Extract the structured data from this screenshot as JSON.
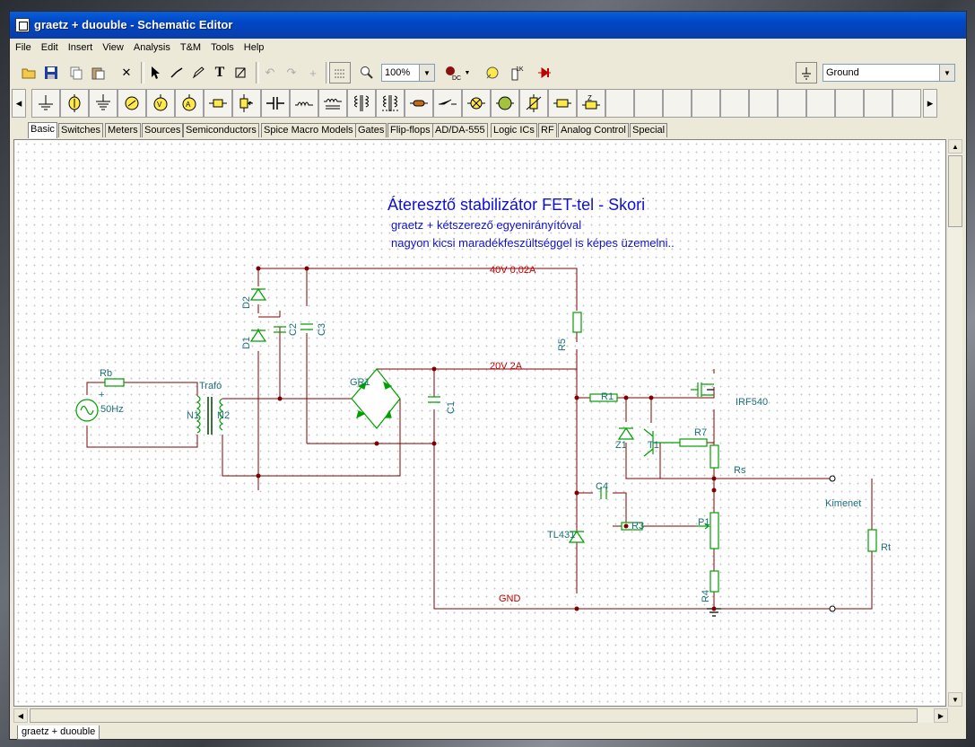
{
  "window": {
    "title": "graetz + duouble - Schematic Editor"
  },
  "menu": [
    "File",
    "Edit",
    "Insert",
    "View",
    "Analysis",
    "T&M",
    "Tools",
    "Help"
  ],
  "toolbar": {
    "zoom": "100%",
    "component": "Ground"
  },
  "component_tabs": [
    "Basic",
    "Switches",
    "Meters",
    "Sources",
    "Semiconductors",
    "Spice Macro Models",
    "Gates",
    "Flip-flops",
    "AD/DA-555",
    "Logic ICs",
    "RF",
    "Analog Control",
    "Special"
  ],
  "active_tab": "Basic",
  "document_tab": "graetz + duouble",
  "schematic": {
    "title": "Áteresztő stabilizátor FET-tel - Skori",
    "subtitle1": "graetz + kétszerező egyenirányítóval",
    "subtitle2": "nagyon kicsi maradékfeszültséggel is képes üzemelni..",
    "net_40v": "40V 0,02A",
    "net_20v": "20V 2A",
    "net_gnd": "GND",
    "labels": {
      "rb": "Rb",
      "hz": "50Hz",
      "plus": "+",
      "trafo": "Trafó",
      "n1": "N1",
      "n2": "N2",
      "d1": "D1",
      "d2": "D2",
      "c2": "C2",
      "c3": "C3",
      "gr1": "GR1",
      "c1": "C1",
      "r5": "R5",
      "r1": "R1",
      "irf540": "IRF540",
      "z1": "Z1",
      "t1": "T1",
      "r7": "R7",
      "rs": "Rs",
      "c4": "C4",
      "tl431": "TL431",
      "r3": "R3",
      "p1": "P1",
      "r4": "R4",
      "kimenet": "Kimenet",
      "rt": "Rt"
    }
  },
  "colors": {
    "wire": "#800000",
    "component": "#00a000",
    "title": "#1010d0",
    "label": "#1a6f7a",
    "net": "#c00000"
  }
}
